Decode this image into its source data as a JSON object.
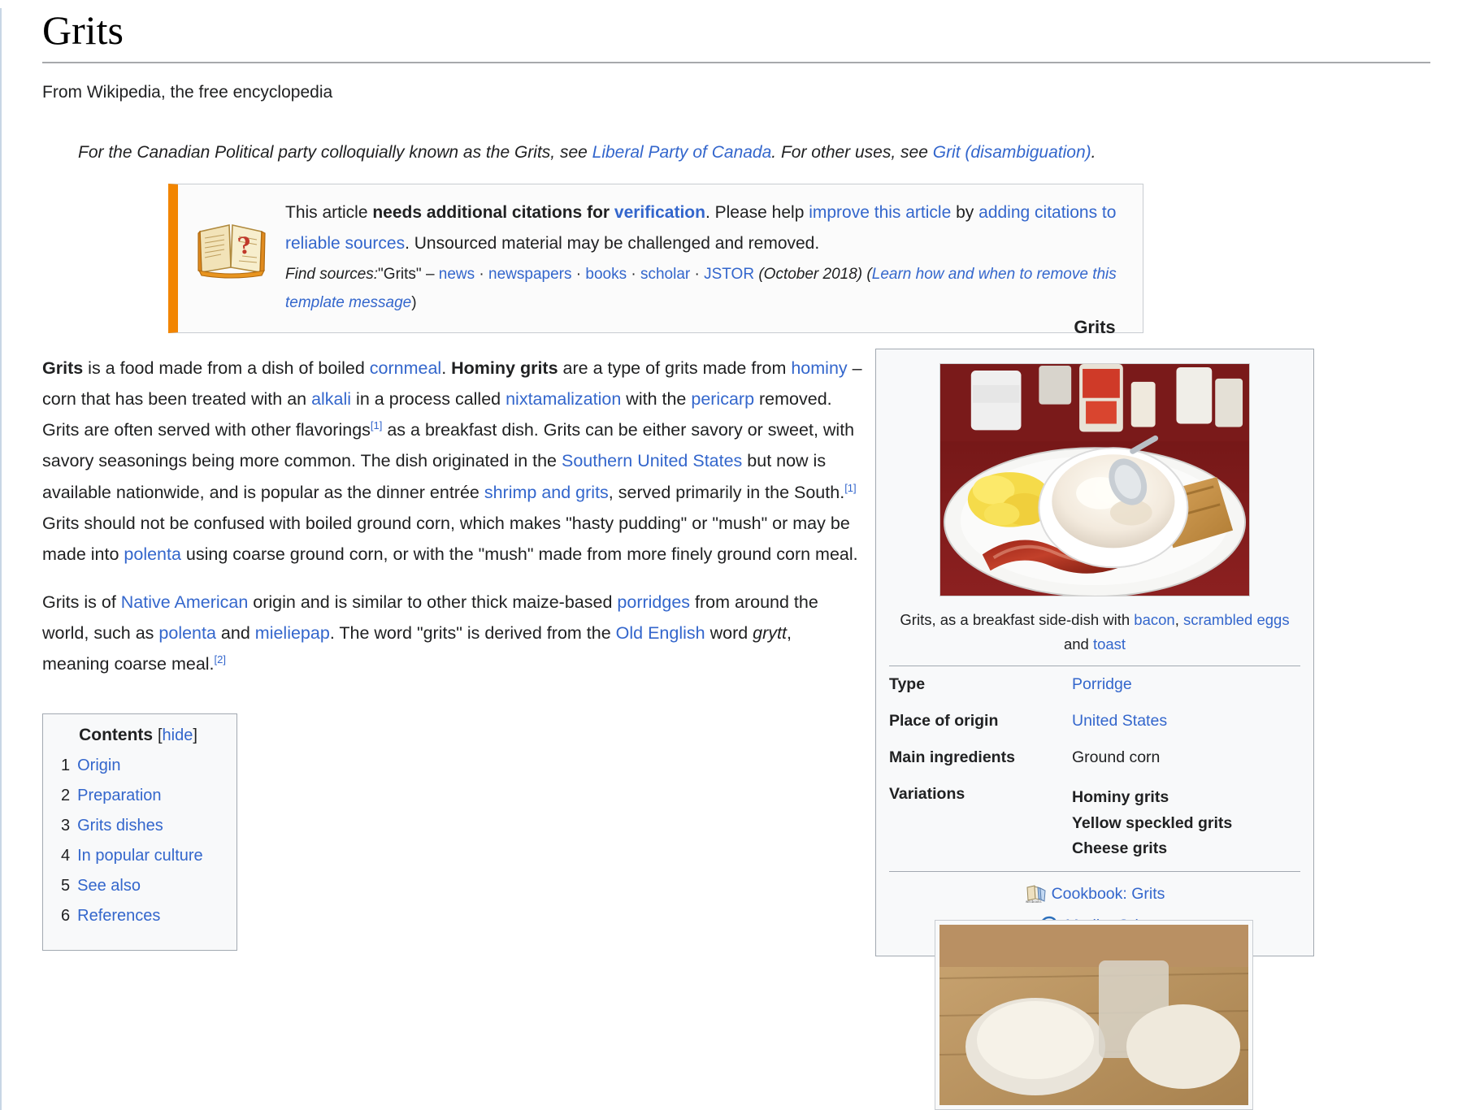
{
  "article": {
    "title": "Grits",
    "tagline": "From Wikipedia, the free encyclopedia"
  },
  "hatnote": {
    "part1": "For the Canadian Political party colloquially known as the Grits, see ",
    "link1": "Liberal Party of Canada",
    "part2": ". For other uses, see ",
    "link2": "Grit (disambiguation)",
    "part3": "."
  },
  "ambox": {
    "icon": "book-question-icon",
    "line1_a": "This article ",
    "line1_b": "needs additional citations for ",
    "line1_link": "verification",
    "line1_c": ". Please help ",
    "line1_link2": "improve this article",
    "line1_d": " by ",
    "line2_link": "adding citations to reliable sources",
    "line2_text": ". Unsourced material may be challenged and removed.",
    "find_sources_label": "Find sources:",
    "find_sources_query": "\"Grits\"",
    "dash": "–",
    "sources": [
      "news",
      "newspapers",
      "books",
      "scholar",
      "JSTOR"
    ],
    "date": "(October 2018)",
    "learn_open": "(",
    "learn_link": "Learn how and when to remove this template message",
    "learn_close": ")"
  },
  "paragraphs": {
    "p1": [
      {
        "t": "Grits",
        "s": "b"
      },
      {
        "t": " is a food made from a dish of boiled ",
        "s": "n"
      },
      {
        "t": "cornmeal",
        "s": "l"
      },
      {
        "t": ". ",
        "s": "n"
      },
      {
        "t": "Hominy grits",
        "s": "b"
      },
      {
        "t": " are a type of grits made from ",
        "s": "n"
      },
      {
        "t": "hominy",
        "s": "l"
      },
      {
        "t": " – corn that has been treated with an ",
        "s": "n"
      },
      {
        "t": "alkali",
        "s": "l"
      },
      {
        "t": " in a process called ",
        "s": "n"
      },
      {
        "t": "nixtamalization",
        "s": "l"
      },
      {
        "t": " with the ",
        "s": "n"
      },
      {
        "t": "pericarp",
        "s": "l"
      },
      {
        "t": " removed. Grits are often served with other flavorings",
        "s": "n"
      },
      {
        "t": "[1]",
        "s": "sup"
      },
      {
        "t": " as a breakfast dish. Grits can be either savory or sweet, with savory seasonings being more common. The dish originated in the ",
        "s": "n"
      },
      {
        "t": "Southern United States",
        "s": "l"
      },
      {
        "t": " but now is available nationwide, and is popular as the dinner entrée ",
        "s": "n"
      },
      {
        "t": "shrimp and grits",
        "s": "l"
      },
      {
        "t": ", served primarily in the South.",
        "s": "n"
      },
      {
        "t": "[1]",
        "s": "sup"
      },
      {
        "t": " Grits should not be confused with boiled ground corn, which makes \"hasty pudding\" or \"mush\" or may be made into ",
        "s": "n"
      },
      {
        "t": "polenta",
        "s": "l"
      },
      {
        "t": " using coarse ground corn, or with the \"mush\" made from more finely ground corn meal.",
        "s": "n"
      }
    ],
    "p2": [
      {
        "t": "Grits is of ",
        "s": "n"
      },
      {
        "t": "Native American",
        "s": "l"
      },
      {
        "t": " origin and is similar to other thick maize-based ",
        "s": "n"
      },
      {
        "t": "porridges",
        "s": "l"
      },
      {
        "t": " from around the world, such as ",
        "s": "n"
      },
      {
        "t": "polenta",
        "s": "l"
      },
      {
        "t": " and ",
        "s": "n"
      },
      {
        "t": "mieliepap",
        "s": "l"
      },
      {
        "t": ". The word \"grits\" is derived from the ",
        "s": "n"
      },
      {
        "t": "Old English",
        "s": "l"
      },
      {
        "t": " word ",
        "s": "n"
      },
      {
        "t": "grytt",
        "s": "i"
      },
      {
        "t": ", meaning coarse meal.",
        "s": "n"
      },
      {
        "t": "[2]",
        "s": "sup"
      }
    ]
  },
  "toc": {
    "title": "Contents",
    "hide_open": "[",
    "hide_label": "hide",
    "hide_close": "]",
    "items": [
      {
        "num": "1",
        "label": "Origin"
      },
      {
        "num": "2",
        "label": "Preparation"
      },
      {
        "num": "3",
        "label": "Grits dishes"
      },
      {
        "num": "4",
        "label": "In popular culture"
      },
      {
        "num": "5",
        "label": "See also"
      },
      {
        "num": "6",
        "label": "References"
      }
    ]
  },
  "infobox": {
    "title": "Grits",
    "image_alt": "plate-of-grits-photo",
    "caption": {
      "a": "Grits, as a breakfast side-dish with ",
      "link1": "bacon",
      "b": ", ",
      "link2": "scrambled eggs",
      "c": " and ",
      "link3": "toast"
    },
    "rows": [
      {
        "label": "Type",
        "value": "Porridge",
        "style": "link"
      },
      {
        "label": "Place of origin",
        "value": "United States",
        "style": "link"
      },
      {
        "label": "Main ingredients",
        "value": "Ground corn",
        "style": "plain"
      }
    ],
    "variations_label": "Variations",
    "variations": [
      "Hominy grits",
      "Yellow speckled grits",
      "Cheese grits"
    ],
    "links": [
      {
        "icon": "wikibooks-icon",
        "label": "Cookbook: Grits"
      },
      {
        "icon": "commons-media-icon",
        "label": "Media: Grits"
      }
    ]
  },
  "colors": {
    "link": "#3366cc",
    "ambox_accent": "#f28500",
    "border": "#a2a9b1",
    "infobox_bg": "#f8f9fa"
  }
}
